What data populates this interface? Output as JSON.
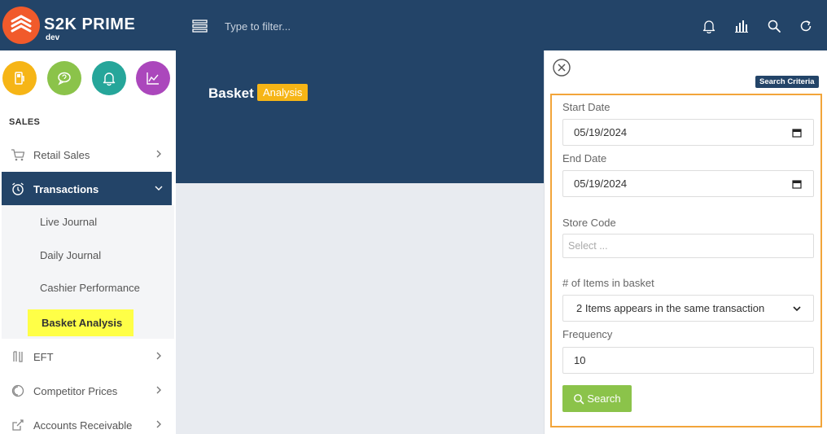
{
  "brand": {
    "name": "S2K PRIME",
    "env": "dev"
  },
  "colors": {
    "header": "#234468",
    "logo": "#f15a2b",
    "accent_yellow": "#f6b516",
    "highlight": "#ffff47",
    "criteria_border": "#f2a53a",
    "search_green": "#8bc34a"
  },
  "topbar": {
    "filter_placeholder": "Type to filter...",
    "icons": [
      "menu-icon",
      "bell-icon",
      "bar-chart-icon",
      "search-icon",
      "refresh-icon"
    ]
  },
  "quick_actions": [
    {
      "name": "fuel-icon",
      "color": "#f6b516"
    },
    {
      "name": "chat-icon",
      "color": "#8bc34a"
    },
    {
      "name": "bell-icon",
      "color": "#26a69a"
    },
    {
      "name": "line-chart-icon",
      "color": "#ab47bc"
    }
  ],
  "sidebar": {
    "section": "SALES",
    "items": [
      {
        "label": "Retail Sales",
        "icon": "cart-icon"
      },
      {
        "label": "Transactions",
        "icon": "alarm-clock-icon",
        "active": true
      },
      {
        "label": "EFT",
        "icon": "eft-icon"
      },
      {
        "label": "Competitor Prices",
        "icon": "coin-icon"
      },
      {
        "label": "Accounts Receivable",
        "icon": "external-link-icon"
      }
    ],
    "subitems": [
      "Live Journal",
      "Daily Journal",
      "Cashier Performance",
      "Basket Analysis"
    ]
  },
  "main": {
    "title": "Basket",
    "badge": "Analysis"
  },
  "panel": {
    "criteria_label": "Search Criteria",
    "start_date_label": "Start Date",
    "start_date_value": "05/19/2024",
    "end_date_label": "End Date",
    "end_date_value": "05/19/2024",
    "store_code_label": "Store Code",
    "store_code_placeholder": "Select ...",
    "items_label": "# of Items in basket",
    "items_value": "2 Items appears in the same transaction",
    "frequency_label": "Frequency",
    "frequency_value": "10",
    "search_label": "Search"
  }
}
